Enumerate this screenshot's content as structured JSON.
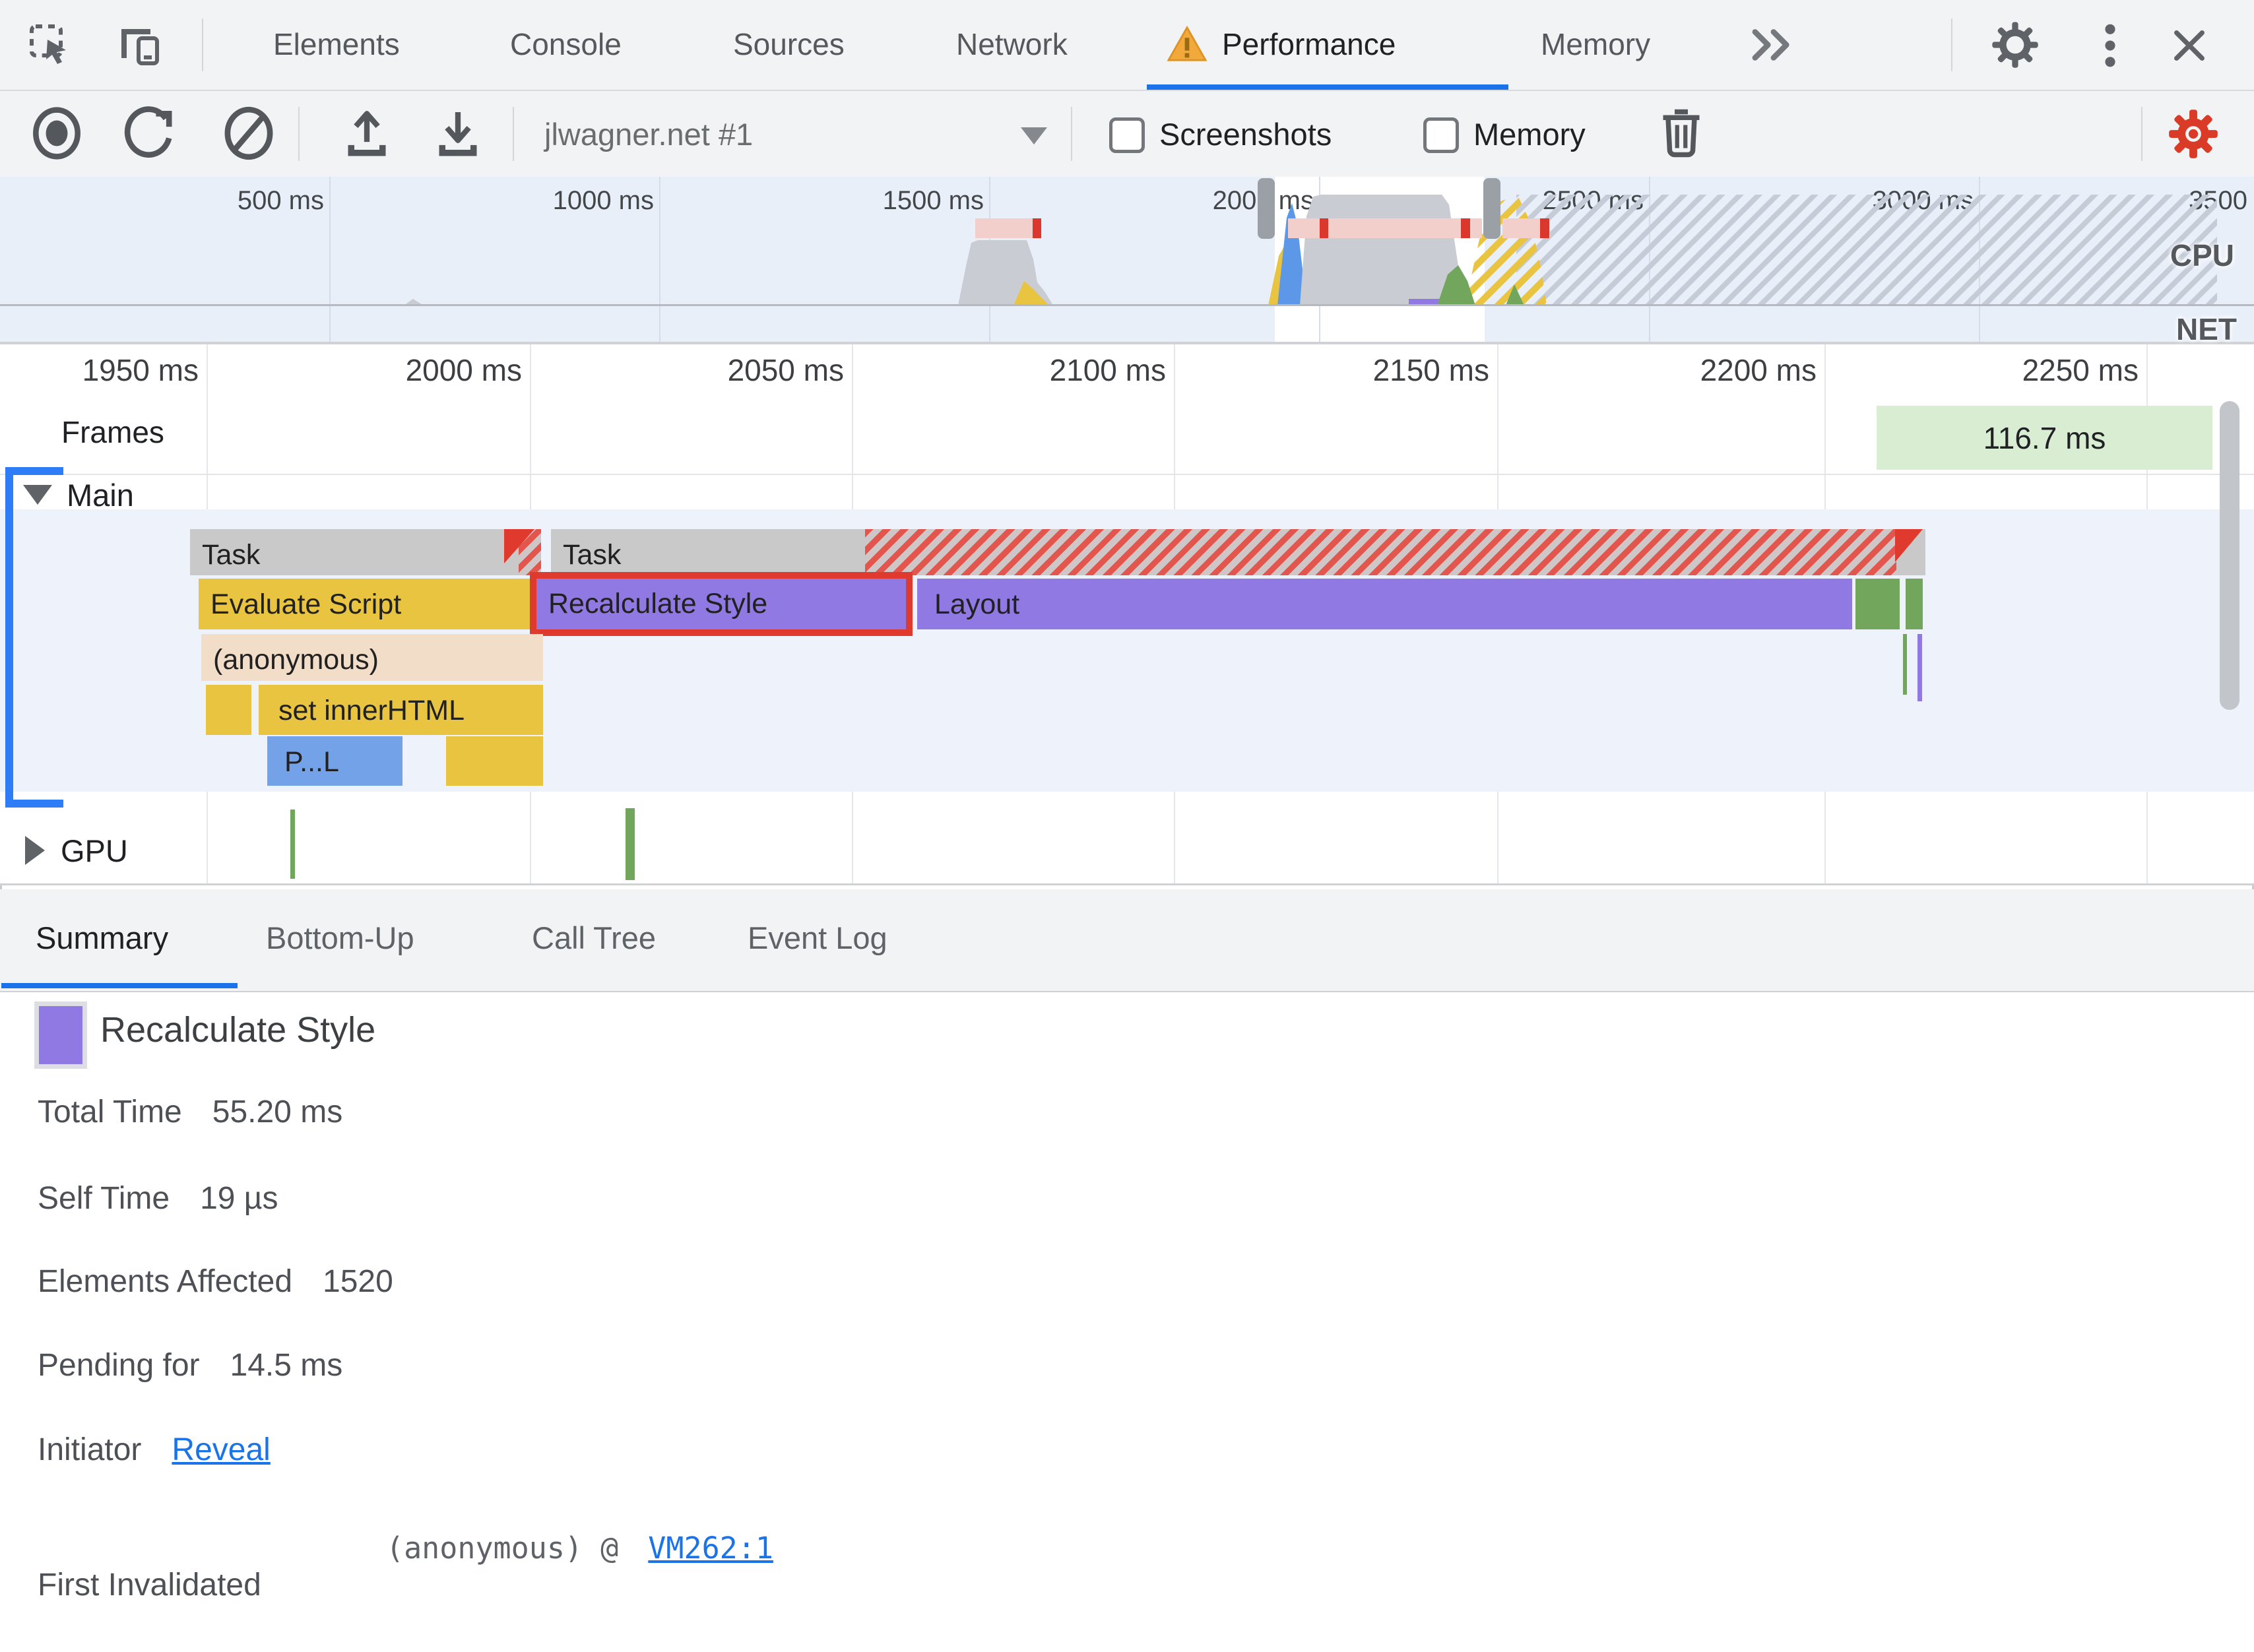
{
  "tabbar": {
    "tabs": [
      "Elements",
      "Console",
      "Sources",
      "Network",
      "Performance",
      "Memory"
    ],
    "active_tab": "Performance"
  },
  "toolbar": {
    "profile_name": "jlwagner.net #1",
    "screenshots_label": "Screenshots",
    "memory_label": "Memory"
  },
  "overview": {
    "ticks": [
      "500 ms",
      "1000 ms",
      "1500 ms",
      "2000 ms",
      "2500 ms",
      "3000 ms",
      "3500"
    ],
    "cpu_label": "CPU",
    "net_label": "NET"
  },
  "ruler": {
    "ticks": [
      "1950 ms",
      "2000 ms",
      "2050 ms",
      "2100 ms",
      "2150 ms",
      "2200 ms",
      "2250 ms"
    ]
  },
  "frames": {
    "label": "Frames",
    "duration": "116.7 ms"
  },
  "main": {
    "label": "Main",
    "task1": "Task",
    "task2": "Task",
    "evaluate_script": "Evaluate Script",
    "recalculate_style": "Recalculate Style",
    "layout": "Layout",
    "anonymous": "(anonymous)",
    "set_inner_html": "set innerHTML",
    "profile_call": "P...L"
  },
  "gpu": {
    "label": "GPU"
  },
  "bottom_tabs": {
    "tabs": [
      "Summary",
      "Bottom-Up",
      "Call Tree",
      "Event Log"
    ],
    "active_tab": "Summary"
  },
  "summary": {
    "title": "Recalculate Style",
    "total_label": "Total Time",
    "total_value": "55.20 ms",
    "self_label": "Self Time",
    "self_value": "19 µs",
    "elements_label": "Elements Affected",
    "elements_value": "1520",
    "pending_label": "Pending for",
    "pending_value": "14.5 ms",
    "initiator_label": "Initiator",
    "initiator_link": "Reveal",
    "first_invalidated_label": "First Invalidated",
    "stack_fn": "(anonymous) @",
    "stack_link": "VM262:1"
  },
  "colors": {
    "accent": "#1a73e8",
    "selection_red": "#df3a2d",
    "purple": "#9179e3",
    "yellow": "#e9c440",
    "green": "#72a65c",
    "task_gray": "#c9c9c9",
    "warning_orange": "#f2a93c",
    "capture_gear_red": "#da3b26",
    "frame_green": "#d9edd3"
  }
}
